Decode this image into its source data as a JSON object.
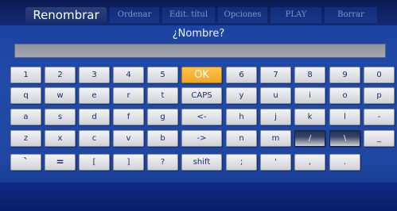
{
  "tabs": [
    {
      "label": "Renombrar"
    },
    {
      "label": "Ordenar"
    },
    {
      "label": "Edit. títul"
    },
    {
      "label": "Opciones"
    },
    {
      "label": "PLAY"
    },
    {
      "label": "Borrar"
    }
  ],
  "prompt": "¿Nombre?",
  "input_value": "",
  "keyboard": {
    "rows": [
      [
        "1",
        "2",
        "3",
        "4",
        "5",
        "OK",
        "6",
        "7",
        "8",
        "9",
        "0"
      ],
      [
        "q",
        "w",
        "e",
        "r",
        "t",
        "CAPS",
        "y",
        "u",
        "i",
        "o",
        "p"
      ],
      [
        "a",
        "s",
        "d",
        "f",
        "g",
        "<-",
        "h",
        "j",
        "k",
        "l",
        "-"
      ],
      [
        "z",
        "x",
        "c",
        "v",
        "b",
        "->",
        "n",
        "m",
        "/",
        "\\",
        "_"
      ],
      [
        "`",
        "=",
        "[",
        "]",
        "?",
        "shift",
        ";",
        "'",
        ",",
        "."
      ]
    ]
  },
  "colors": {
    "accent_ok": "#f0a623",
    "background": "#1f47a1",
    "key_text": "#1a2c6e"
  }
}
